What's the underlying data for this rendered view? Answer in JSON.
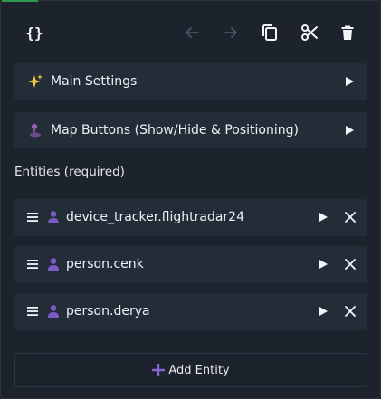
{
  "toolbar": {
    "code_icon_glyph": "{}",
    "undo_icon": "arrow-left-icon",
    "redo_icon": "arrow-right-icon",
    "copy_icon": "copy-icon",
    "cut_icon": "scissors-icon",
    "delete_icon": "trash-icon"
  },
  "sections": [
    {
      "label": "Main Settings",
      "icon": "sparkles-icon"
    },
    {
      "label": "Map Buttons (Show/Hide & Positioning)",
      "icon": "joystick-icon"
    }
  ],
  "entities_title": "Entities (required)",
  "entities": [
    {
      "label": "device_tracker.flightradar24"
    },
    {
      "label": "person.cenk"
    },
    {
      "label": "person.derya"
    }
  ],
  "add_entity_label": "Add Entity",
  "colors": {
    "background": "#1c232c",
    "panel": "#232d38",
    "accent_purple": "#8a64d6",
    "green_accent": "#2e9a4c"
  }
}
